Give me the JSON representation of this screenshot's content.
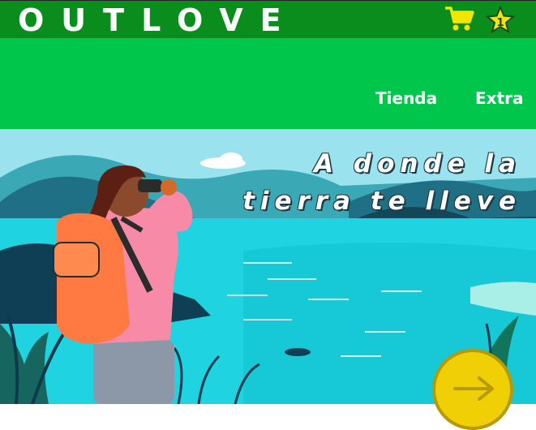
{
  "header": {
    "logo": "OUTLOVE",
    "icons": [
      "cart-icon",
      "star-icon"
    ],
    "color": "#0b8d1e"
  },
  "nav": {
    "color": "#00c74c",
    "links": [
      {
        "label": "Tienda"
      },
      {
        "label": "Extra"
      }
    ]
  },
  "hero": {
    "tagline_line1": "A donde la",
    "tagline_line2": "tierra te lleve",
    "next_icon": "arrow-right-icon",
    "button_color": "#f1cf06"
  }
}
